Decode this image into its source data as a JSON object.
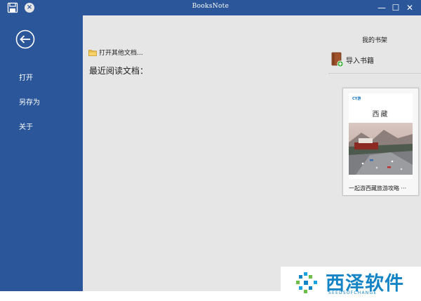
{
  "titlebar": {
    "title": "BooksNote",
    "minimize": "—",
    "maximize": "☐",
    "close": "✕",
    "close_circle": "×"
  },
  "sidebar": {
    "items": [
      {
        "label": "打开"
      },
      {
        "label": "另存为"
      },
      {
        "label": "关于"
      }
    ]
  },
  "main": {
    "open_other_label": "打开其他文档...",
    "recent_title": "最近阅读文档："
  },
  "shelf": {
    "title": "我的书架",
    "import_label": "导入书籍",
    "books": [
      {
        "cover_title": "西藏",
        "cover_logo": "CY游",
        "label": "一起游西藏旅游攻略 ···"
      }
    ]
  },
  "watermark": {
    "text": "西泽软件",
    "sub": "SEEDSOFCHANGE"
  },
  "colors": {
    "accent": "#2b579a",
    "background": "#e6e6e6",
    "watermark": "#1584c5"
  }
}
